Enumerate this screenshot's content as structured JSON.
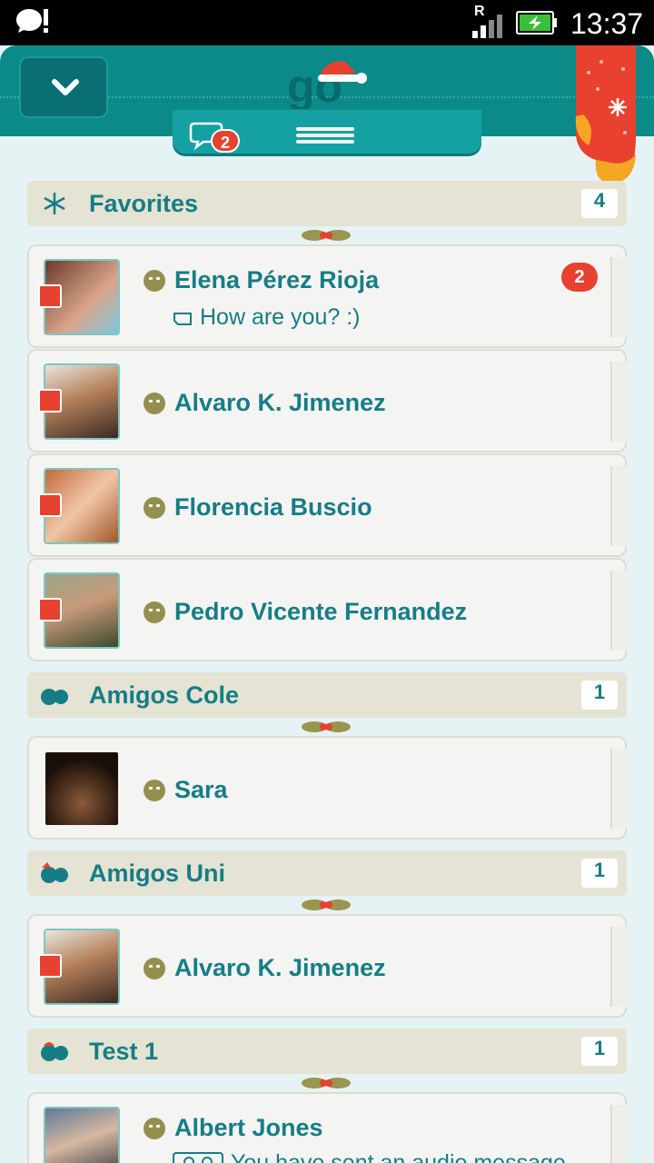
{
  "statusbar": {
    "roaming": "R",
    "time": "13:37",
    "icons": [
      "notification-app-icon",
      "signal-icon",
      "battery-charging-icon"
    ]
  },
  "header": {
    "logo_text": "go",
    "tabs": [
      {
        "name": "chats",
        "icon": "speech-bubble-icon",
        "badge": "2"
      },
      {
        "name": "contacts",
        "icon": "list-icon"
      }
    ],
    "back_icon": "chevron-down-icon"
  },
  "colors": {
    "accent": "#0c8a8a",
    "text": "#167d86",
    "badge": "#e8412f",
    "row_bg": "#f4f4f2",
    "group_bg": "#e4e3d4"
  },
  "groups": [
    {
      "title": "Favorites",
      "count": "4",
      "icon": "snowflake-icon",
      "contacts": [
        {
          "name": "Elena Pérez Rioja",
          "message": "How are you? :)",
          "unread": "2"
        },
        {
          "name": "Alvaro K. Jimenez"
        },
        {
          "name": "Florencia Buscio"
        },
        {
          "name": "Pedro Vicente Fernandez"
        }
      ]
    },
    {
      "title": "Amigos Cole",
      "count": "1",
      "icon": "ornaments-icon",
      "contacts": [
        {
          "name": "Sara"
        }
      ]
    },
    {
      "title": "Amigos Uni",
      "count": "1",
      "icon": "ornaments-icon",
      "contacts": [
        {
          "name": "Alvaro K. Jimenez"
        }
      ]
    },
    {
      "title": "Test 1",
      "count": "1",
      "icon": "ornaments-icon",
      "contacts": [
        {
          "name": "Albert Jones",
          "message": "You have sent an audio message"
        }
      ]
    }
  ]
}
